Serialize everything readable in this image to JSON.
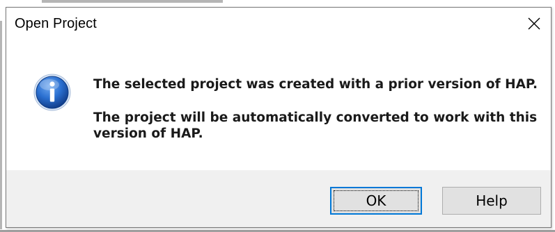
{
  "dialog": {
    "title": "Open Project",
    "close_icon": "close-icon",
    "icon": "information-icon",
    "message_line1": "The selected project was created with a prior version of HAP.",
    "message_line2_a": "The project will be automatically converted to work with this",
    "message_line2_b": "version of HAP.",
    "buttons": {
      "ok_label": "OK",
      "help_label": "Help"
    }
  },
  "colors": {
    "accent": "#0078d7",
    "footer_bg": "#f0f0f0",
    "button_bg": "#e1e1e1",
    "icon_blue": "#1c5fb8"
  }
}
